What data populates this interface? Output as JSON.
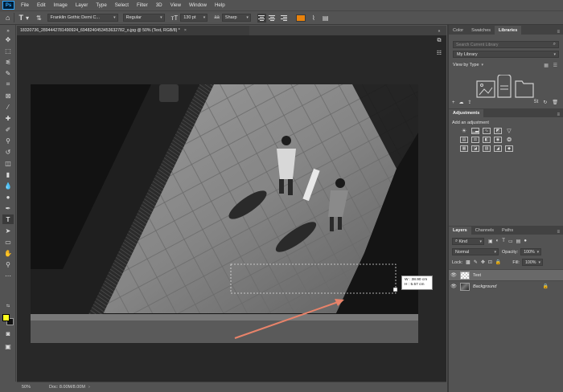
{
  "app": {
    "logo_text": "Ps"
  },
  "menu": [
    "File",
    "Edit",
    "Image",
    "Layer",
    "Type",
    "Select",
    "Filter",
    "3D",
    "View",
    "Window",
    "Help"
  ],
  "options_bar": {
    "font_family": "Franklin Gothic Demi C...",
    "font_style": "Regular",
    "font_size": "130 pt",
    "antialias": "Sharp",
    "text_color": "#e8820c"
  },
  "document": {
    "tab_title": "18320736_2894442781490924_6948240453453632782_o.jpg @ 50% (Text, RGB/8) *",
    "tab_close": "×"
  },
  "status": {
    "zoom": "50%",
    "doc_info": "Doc: 8.00M/8.00M",
    "arrow": "›"
  },
  "transform_readout": {
    "w": "W :  38.90 cm",
    "h": "H :    5.57 cm"
  },
  "colors": {
    "foreground": "#ffff1e",
    "background": "#111111",
    "accent_arrow": "#e8836a"
  },
  "libraries_panel": {
    "tabs": [
      "Color",
      "Swatches",
      "Libraries"
    ],
    "active_tab": "Libraries",
    "search_placeholder": "Search Current Library",
    "library_name": "My Library",
    "view_by": "View by Type"
  },
  "adjustments_panel": {
    "title": "Adjustments",
    "add_label": "Add an adjustment"
  },
  "layers_panel": {
    "tabs": [
      "Layers",
      "Channels",
      "Paths"
    ],
    "active_tab": "Layers",
    "filter_kind": "Kind",
    "blend_mode": "Normal",
    "opacity_label": "Opacity:",
    "opacity_value": "100%",
    "lock_label": "Lock:",
    "fill_label": "Fill:",
    "fill_value": "100%",
    "layers": [
      {
        "name": "Text",
        "selected": true
      },
      {
        "name": "Background",
        "selected": false
      }
    ]
  }
}
